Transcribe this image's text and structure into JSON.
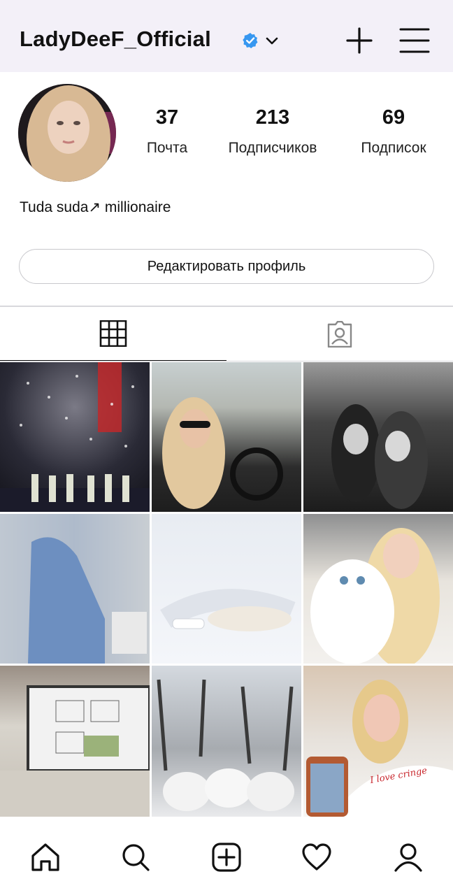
{
  "header": {
    "username": "LadyDeeF_Official",
    "verified_icon": "verified-badge-icon",
    "accent": "#3797f0"
  },
  "profile": {
    "stats": [
      {
        "value": "37",
        "label": "Почта"
      },
      {
        "value": "213",
        "label": "Подписчиков"
      },
      {
        "value": "69",
        "label": "Подписок"
      }
    ],
    "bio": "Tuda suda↗ millionaire",
    "edit_button": "Редактировать профиль"
  },
  "tabs": [
    {
      "icon": "grid-icon",
      "active": true
    },
    {
      "icon": "tagged-icon",
      "active": false
    }
  ],
  "posts": [
    {
      "caption": ""
    },
    {
      "caption": ""
    },
    {
      "caption": ""
    },
    {
      "caption": ""
    },
    {
      "caption": ""
    },
    {
      "caption": ""
    },
    {
      "caption": ""
    },
    {
      "caption": ""
    },
    {
      "caption": "I love cringe"
    }
  ],
  "bottom_nav": [
    "home-icon",
    "search-icon",
    "new-post-icon",
    "activity-heart-icon",
    "profile-icon"
  ]
}
